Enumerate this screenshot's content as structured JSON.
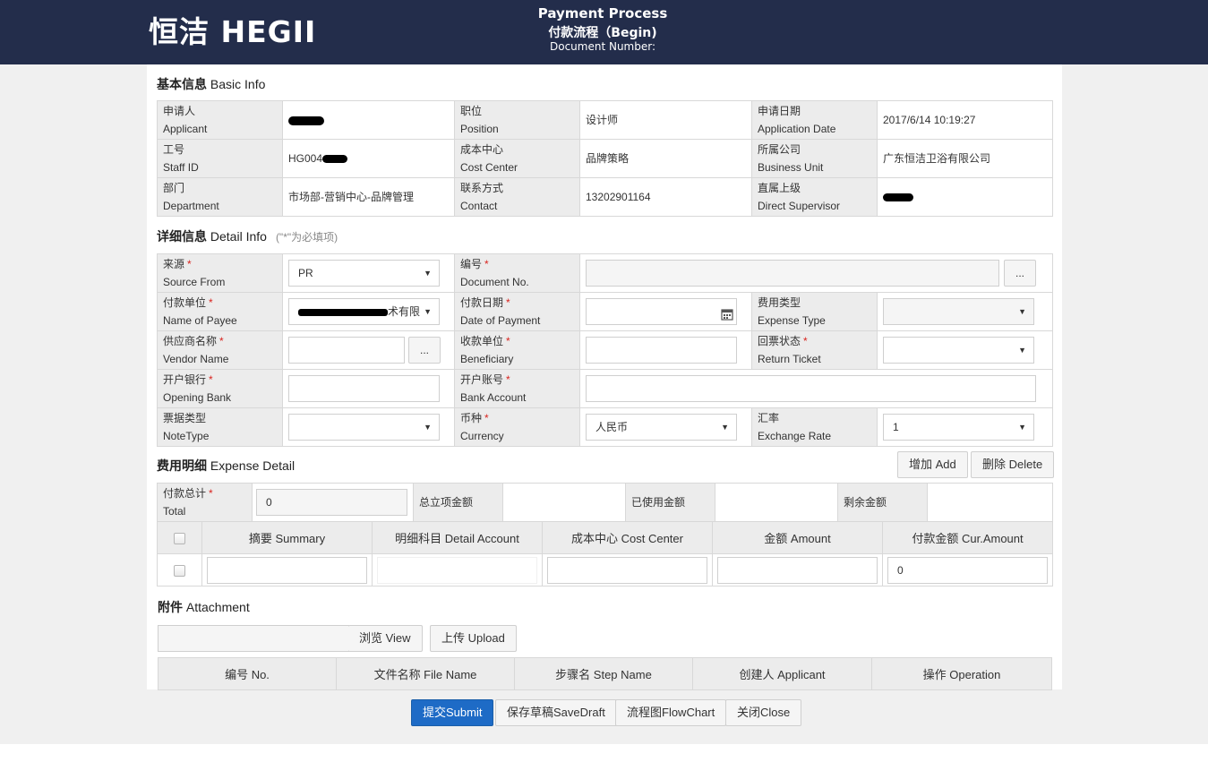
{
  "header": {
    "logo_text": "恒洁 HEGII",
    "title": "Payment Process",
    "subtitle": "付款流程（Begin)",
    "doc_number_label": "Document Number:"
  },
  "basic_info": {
    "title_cn": "基本信息",
    "title_en": "Basic Info",
    "rows": [
      [
        {
          "cn": "申请人",
          "en": "Applicant",
          "value": ""
        },
        {
          "cn": "职位",
          "en": "Position",
          "value": "设计师"
        },
        {
          "cn": "申请日期",
          "en": "Application Date",
          "value": "2017/6/14 10:19:27"
        }
      ],
      [
        {
          "cn": "工号",
          "en": "Staff ID",
          "value": "HG004"
        },
        {
          "cn": "成本中心",
          "en": "Cost Center",
          "value": "品牌策略"
        },
        {
          "cn": "所属公司",
          "en": "Business Unit",
          "value": "广东恒洁卫浴有限公司"
        }
      ],
      [
        {
          "cn": "部门",
          "en": "Department",
          "value": "市场部-营销中心-品牌管理"
        },
        {
          "cn": "联系方式",
          "en": "Contact",
          "value": "13202901164"
        },
        {
          "cn": "直属上级",
          "en": "Direct Supervisor",
          "value": ""
        }
      ]
    ]
  },
  "detail_info": {
    "title_cn": "详细信息",
    "title_en": "Detail Info",
    "hint": "(\"*\"为必填项)",
    "source": {
      "cn": "来源",
      "en": "Source From",
      "value": "PR"
    },
    "document_no": {
      "cn": "编号",
      "en": "Document No.",
      "value": ""
    },
    "payee": {
      "cn": "付款单位",
      "en": "Name of Payee",
      "value": "术有限"
    },
    "payment_date": {
      "cn": "付款日期",
      "en": "Date of Payment",
      "value": ""
    },
    "expense_type": {
      "cn": "费用类型",
      "en": "Expense Type",
      "value": ""
    },
    "vendor": {
      "cn": "供应商名称",
      "en": "Vendor Name",
      "value": ""
    },
    "beneficiary": {
      "cn": "收款单位",
      "en": "Beneficiary",
      "value": ""
    },
    "return_ticket": {
      "cn": "回票状态",
      "en": "Return Ticket",
      "value": ""
    },
    "opening_bank": {
      "cn": "开户银行",
      "en": "Opening Bank",
      "value": ""
    },
    "bank_account": {
      "cn": "开户账号",
      "en": "Bank Account",
      "value": ""
    },
    "note_type": {
      "cn": "票据类型",
      "en": "NoteType",
      "value": ""
    },
    "currency": {
      "cn": "币种",
      "en": "Currency",
      "value": "人民币"
    },
    "exchange_rate": {
      "cn": "汇率",
      "en": "Exchange Rate",
      "value": "1"
    },
    "dots": "..."
  },
  "expense_detail": {
    "title_cn": "费用明细",
    "title_en": "Expense Detail",
    "add_label": "增加 Add",
    "delete_label": "删除 Delete",
    "total_cn": "付款总计",
    "total_en": "Total",
    "total_value": "0",
    "budget_label": "总立项金额",
    "used_label": "已使用金额",
    "remaining_label": "剩余金额",
    "columns": [
      "摘要 Summary",
      "明细科目 Detail Account",
      "成本中心 Cost Center",
      "金额 Amount",
      "付款金额 Cur.Amount"
    ],
    "row_cur_amount": "0"
  },
  "attachment": {
    "title_cn": "附件",
    "title_en": "Attachment",
    "view_label": "浏览 View",
    "upload_label": "上传 Upload",
    "columns": [
      "编号 No.",
      "文件名称 File Name",
      "步骤名 Step Name",
      "创建人 Applicant",
      "操作 Operation"
    ]
  },
  "actions": {
    "submit": "提交Submit",
    "save_draft": "保存草稿SaveDraft",
    "flowchart": "流程图FlowChart",
    "close": "关闭Close"
  },
  "colors": {
    "header_bg": "#232d4b",
    "submit_bg": "#1e6bc6",
    "required": "#d9241f"
  }
}
